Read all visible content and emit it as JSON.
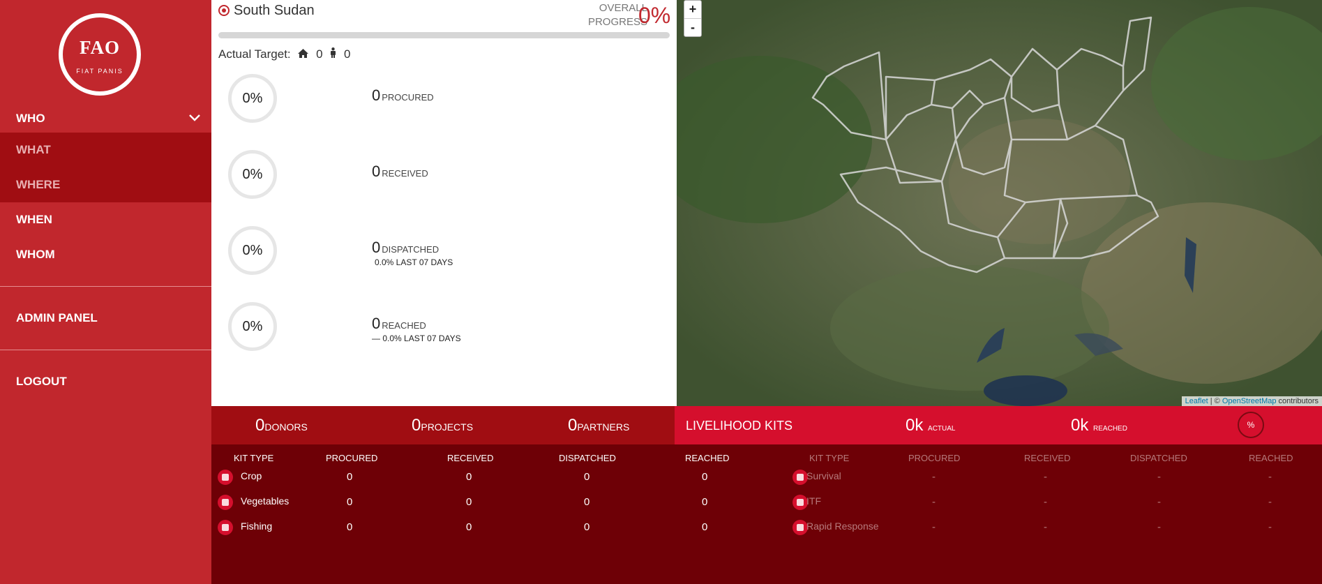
{
  "logo": {
    "letters": "FAO",
    "motto": "FIAT PANIS"
  },
  "nav": {
    "who": "WHO",
    "what": "WHAT",
    "where": "WHERE",
    "when": "WHEN",
    "whom": "WHOM",
    "admin": "ADMIN PANEL",
    "logout": "LOGOUT"
  },
  "summary": {
    "country": "South Sudan",
    "overall_label": "OVERALL PROGRESS",
    "overall_value": "0%",
    "progress_fraction": 0,
    "actual_target_label": "Actual Target:",
    "households": "0",
    "people": "0",
    "stats": [
      {
        "percent": "0%",
        "value": "0",
        "label": "PROCURED",
        "sub": ""
      },
      {
        "percent": "0%",
        "value": "0",
        "label": "RECEIVED",
        "sub": ""
      },
      {
        "percent": "0%",
        "value": "0",
        "label": "DISPATCHED",
        "sub": "0.0% LAST 07 DAYS"
      },
      {
        "percent": "0%",
        "value": "0",
        "label": "REACHED",
        "sub": "0.0% LAST 07 DAYS"
      }
    ]
  },
  "map": {
    "zoom_in": "+",
    "zoom_out": "-",
    "attribution_leaflet": "Leaflet",
    "attribution_sep": " | © ",
    "attribution_osm": "OpenStreetMap",
    "attribution_tail": " contributors"
  },
  "bar": {
    "donors_value": "0",
    "donors_label": "DONORS",
    "projects_value": "0",
    "projects_label": "PROJECTS",
    "partners_value": "0",
    "partners_label": "PARTNERS",
    "kits_title": "LIVELIHOOD KITS",
    "actual_value": "0k",
    "actual_label": "ACTUAL",
    "reached_value": "0k",
    "reached_label": "REACHED",
    "percent_symbol": "%"
  },
  "table_left": {
    "headers": [
      "KIT TYPE",
      "PROCURED",
      "RECEIVED",
      "DISPATCHED",
      "REACHED"
    ],
    "rows": [
      {
        "name": "Crop",
        "icon": "crop-icon",
        "procured": "0",
        "received": "0",
        "dispatched": "0",
        "reached": "0"
      },
      {
        "name": "Vegetables",
        "icon": "vegetables-icon",
        "procured": "0",
        "received": "0",
        "dispatched": "0",
        "reached": "0"
      },
      {
        "name": "Fishing",
        "icon": "fishing-icon",
        "procured": "0",
        "received": "0",
        "dispatched": "0",
        "reached": "0"
      }
    ]
  },
  "table_right": {
    "headers": [
      "KIT TYPE",
      "PROCURED",
      "RECEIVED",
      "DISPATCHED",
      "REACHED"
    ],
    "rows": [
      {
        "name": "Survival",
        "icon": "survival-icon",
        "procured": "-",
        "received": "-",
        "dispatched": "-",
        "reached": "-"
      },
      {
        "name": "ITF",
        "icon": "itf-icon",
        "procured": "-",
        "received": "-",
        "dispatched": "-",
        "reached": "-"
      },
      {
        "name": "Rapid Response",
        "icon": "rapid-response-icon",
        "procured": "-",
        "received": "-",
        "dispatched": "-",
        "reached": "-"
      }
    ]
  },
  "colors": {
    "brand_red": "#c1272d",
    "dark_red": "#a00d12",
    "bright_red": "#d50f2d",
    "table_bg": "#6e0006"
  }
}
